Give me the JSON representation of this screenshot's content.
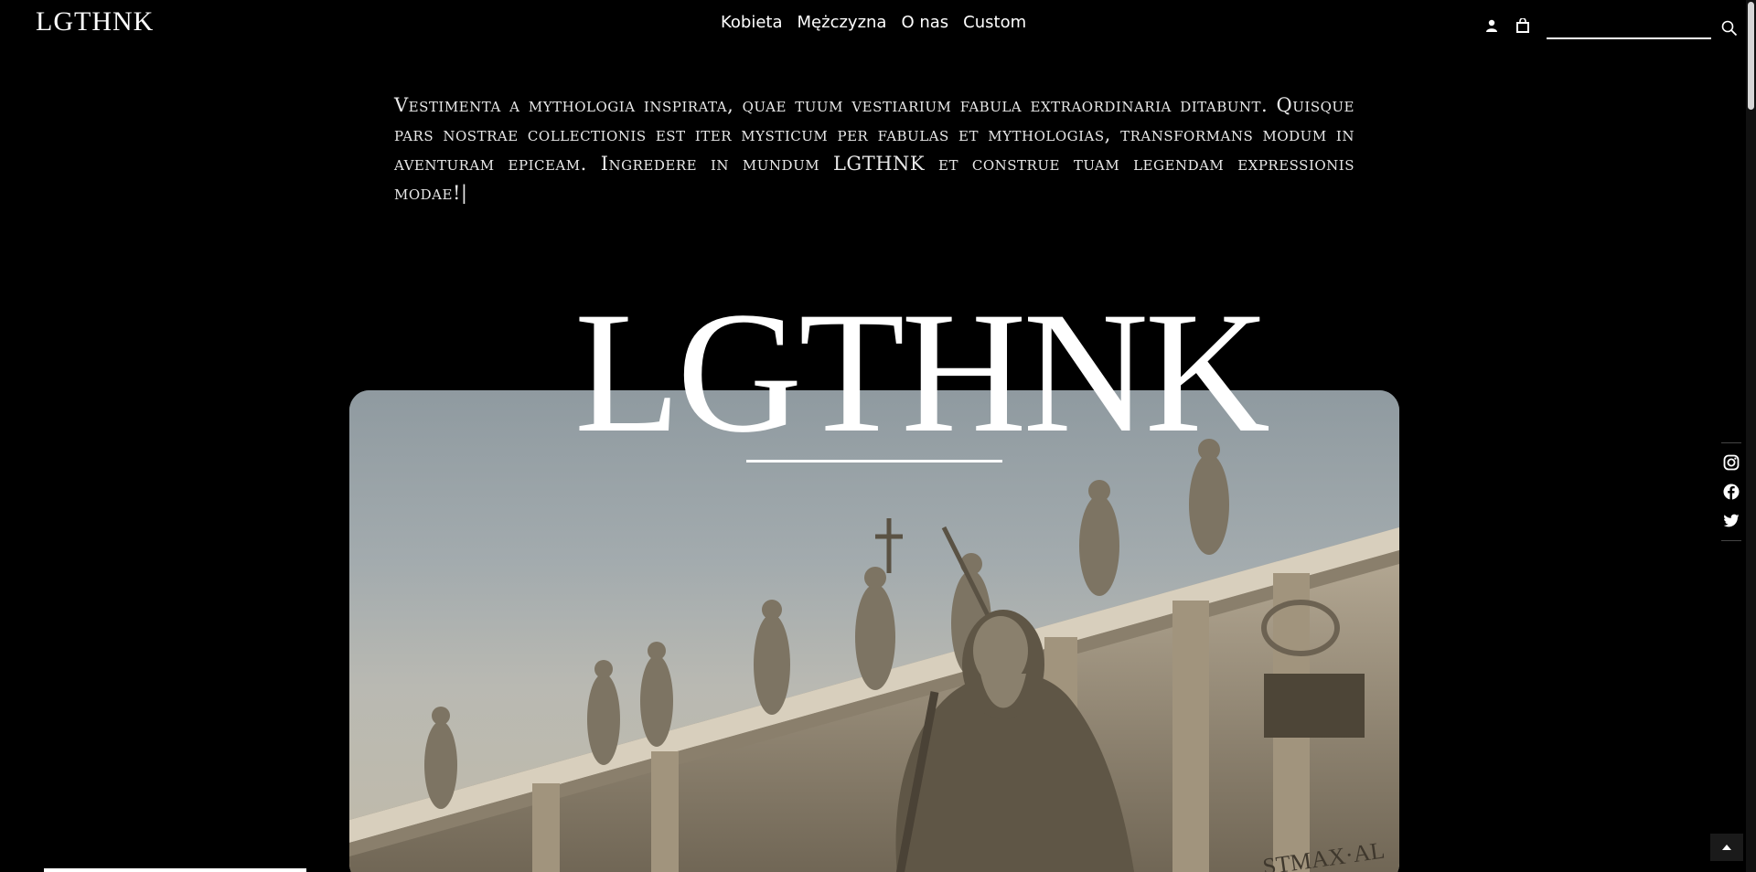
{
  "header": {
    "logo": "LGTHNK",
    "nav": [
      "Kobieta",
      "Mężczyzna",
      "O nas",
      "Custom"
    ],
    "search_placeholder": "",
    "icons": [
      "user-icon",
      "cart-icon",
      "search-icon"
    ]
  },
  "intro": {
    "text": "Vestimenta a mythologia inspirata, quae tuum vestiarium fabula extraordinaria ditabunt. Quisque pars nostrae collectionis est iter mysticum per fabulas et mythologias, transformans modum in aventuram epiceam. Ingredere in mundum LGTHNK et construe tuam legendam expressionis modae!|"
  },
  "hero": {
    "logo": "LGTHNK",
    "image": "basilica-statues-photo",
    "inscription": "STMAX·AL"
  },
  "social": {
    "icons": [
      "instagram-icon",
      "facebook-icon",
      "twitter-icon"
    ]
  },
  "colors": {
    "background": "#000000",
    "text": "#ffffff"
  }
}
